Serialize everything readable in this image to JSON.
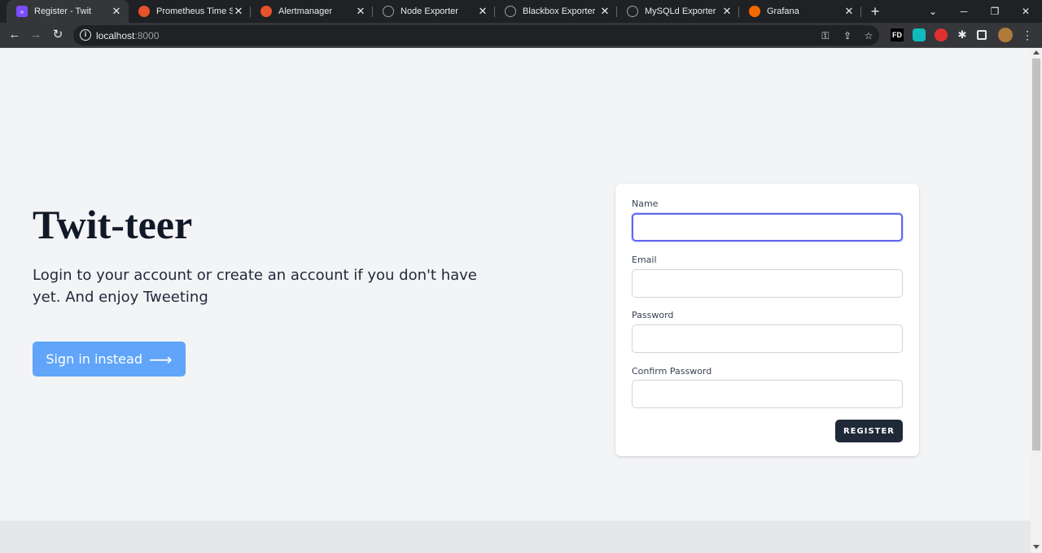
{
  "browser": {
    "tabs": [
      {
        "title": "Register - Twit",
        "favicon": "vite-icon",
        "color": "#7c4dff"
      },
      {
        "title": "Prometheus Time Seri",
        "favicon": "prometheus-icon",
        "color": "#e6522c"
      },
      {
        "title": "Alertmanager",
        "favicon": "prometheus-icon",
        "color": "#e6522c"
      },
      {
        "title": "Node Exporter",
        "favicon": "globe-icon",
        "color": "#9aa0a6"
      },
      {
        "title": "Blackbox Exporter",
        "favicon": "globe-icon",
        "color": "#9aa0a6"
      },
      {
        "title": "MySQLd Exporter",
        "favicon": "globe-icon",
        "color": "#9aa0a6"
      },
      {
        "title": "Grafana",
        "favicon": "grafana-icon",
        "color": "#f46800"
      }
    ],
    "url_host": "localhost",
    "url_port": ":8000",
    "extensions": {
      "fd": "FD"
    }
  },
  "hero": {
    "title": "Twit-teer",
    "subtitle": "Login to your account or create an account if you don't have yet. And enjoy Tweeting",
    "signin_label": "Sign in instead"
  },
  "form": {
    "name_label": "Name",
    "email_label": "Email",
    "password_label": "Password",
    "confirm_label": "Confirm Password",
    "name_value": "",
    "email_value": "",
    "password_value": "",
    "confirm_value": "",
    "register_label": "REGISTER"
  },
  "colors": {
    "accent": "#60a5fa",
    "focus": "#6366f1",
    "dark_button": "#1f2937"
  }
}
